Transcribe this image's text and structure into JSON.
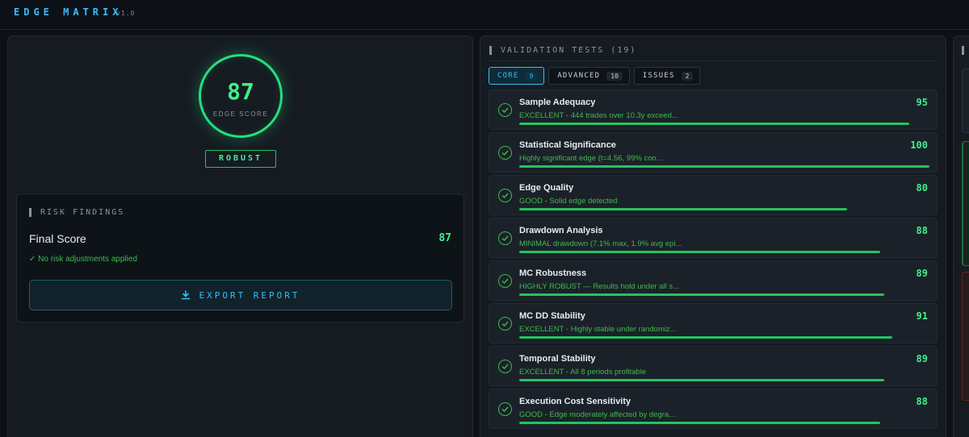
{
  "app": {
    "title": "EDGE MATRIX",
    "version": "v1.0"
  },
  "score": {
    "value": "87",
    "label": "EDGE SCORE",
    "rating": "ROBUST",
    "ring_color": "#22e07a"
  },
  "risk": {
    "title": "RISK FINDINGS",
    "final_label": "Final Score",
    "final_value": "87",
    "note": "✓ No risk adjustments applied",
    "export_label": "EXPORT REPORT",
    "export_icon": "download-icon"
  },
  "validation": {
    "title": "VALIDATION TESTS (19)",
    "tabs": [
      {
        "label": "CORE",
        "count": "9"
      },
      {
        "label": "ADVANCED",
        "count": "10"
      },
      {
        "label": "ISSUES",
        "count": "2"
      }
    ],
    "tests": [
      {
        "name": "Sample Adequacy",
        "desc": "EXCELLENT - 444 trades over 10.3y exceed...",
        "score": "95",
        "bar": 0.95
      },
      {
        "name": "Statistical Significance",
        "desc": "Highly significant edge (t=4.56, 99% con...",
        "score": "100",
        "bar": 1.0
      },
      {
        "name": "Edge Quality",
        "desc": "GOOD - Solid edge detected",
        "score": "80",
        "bar": 0.8
      },
      {
        "name": "Drawdown Analysis",
        "desc": "MINIMAL drawdown (7.1% max, 1.9% avg epi...",
        "score": "88",
        "bar": 0.88
      },
      {
        "name": "MC Robustness",
        "desc": "HIGHLY ROBUST — Results hold under all s...",
        "score": "89",
        "bar": 0.89
      },
      {
        "name": "MC DD Stability",
        "desc": "EXCELLENT - Highly stable under randomiz...",
        "score": "91",
        "bar": 0.91
      },
      {
        "name": "Temporal Stability",
        "desc": "EXCELLENT - All 8 periods profitable",
        "score": "89",
        "bar": 0.89
      },
      {
        "name": "Execution Cost Sensitivity",
        "desc": "GOOD - Edge moderately affected by degra...",
        "score": "88",
        "bar": 0.88
      }
    ],
    "pass_icon": "check-circle-icon",
    "accent": "#38bdf8",
    "pass_color": "#3fb950"
  }
}
